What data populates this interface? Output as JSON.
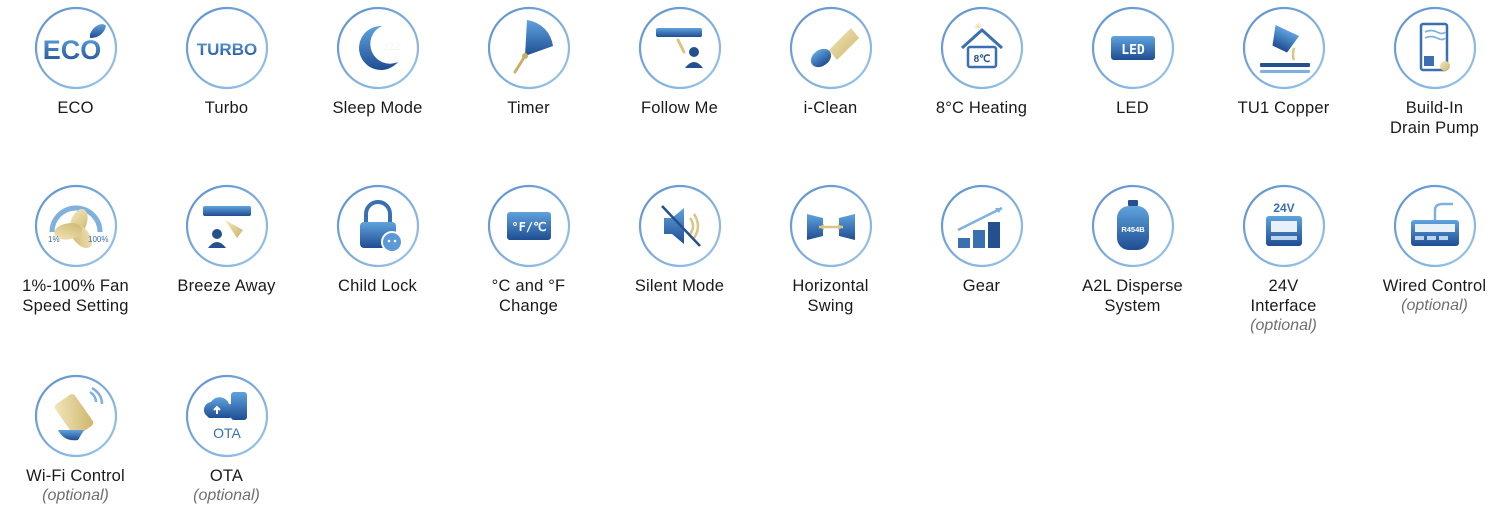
{
  "colors": {
    "ring": "#7fa6d2",
    "blue": "#3a6fb0",
    "blue_dark": "#24508f",
    "blue_light": "#8fc3ea",
    "gold": "#e6d59c"
  },
  "features": [
    {
      "label": "ECO",
      "icon": "eco-leaf-icon",
      "text": "ECO"
    },
    {
      "label": "Turbo",
      "icon": "turbo-icon",
      "text": "TURBO"
    },
    {
      "label": "Sleep Mode",
      "icon": "moon-sleep-icon",
      "text": "zZZ"
    },
    {
      "label": "Timer",
      "icon": "timer-fan-icon"
    },
    {
      "label": "Follow Me",
      "icon": "follow-me-icon"
    },
    {
      "label": "i-Clean",
      "icon": "i-clean-icon"
    },
    {
      "label": "8°C Heating",
      "icon": "house-heating-icon",
      "text": "8℃"
    },
    {
      "label": "LED",
      "icon": "led-display-icon",
      "text": "LED"
    },
    {
      "label": "TU1 Copper",
      "icon": "copper-pour-icon"
    },
    {
      "label": "Build-In",
      "label2": "Drain Pump",
      "icon": "drain-pump-icon"
    },
    {
      "label": "1%-100% Fan",
      "label2": "Speed Setting",
      "icon": "fan-speed-icon",
      "text": "1%",
      "text2": "100%"
    },
    {
      "label": "Breeze Away",
      "icon": "breeze-away-icon"
    },
    {
      "label": "Child Lock",
      "icon": "child-lock-icon"
    },
    {
      "label": "°C and °F",
      "label2": "Change",
      "icon": "temp-unit-icon",
      "text": "°F/℃"
    },
    {
      "label": "Silent Mode",
      "icon": "speaker-mute-icon"
    },
    {
      "label": "Horizontal",
      "label2": "Swing",
      "icon": "horizontal-swing-icon"
    },
    {
      "label": "Gear",
      "icon": "gear-bars-icon"
    },
    {
      "label": "A2L Disperse",
      "label2": "System",
      "icon": "gas-cylinder-icon",
      "text": "R454B"
    },
    {
      "label": "24V",
      "label2": "Interface",
      "optional": "(optional)",
      "icon": "interface-24v-icon",
      "text": "24V"
    },
    {
      "label": "Wired Control",
      "optional": "(optional)",
      "icon": "wired-control-icon"
    },
    {
      "label": "Wi-Fi Control",
      "optional": "(optional)",
      "icon": "wifi-phone-icon"
    },
    {
      "label": "OTA",
      "optional": "(optional)",
      "icon": "ota-cloud-phone-icon",
      "text": "OTA"
    }
  ]
}
